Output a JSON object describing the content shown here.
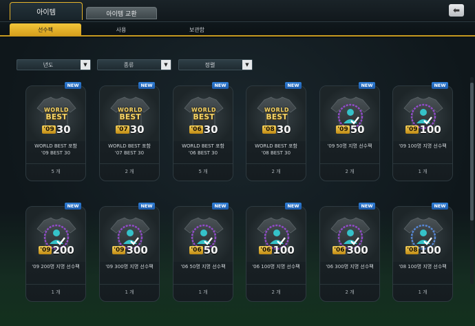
{
  "main_tabs": [
    {
      "label": "아이템",
      "active": true
    },
    {
      "label": "아이템 교환",
      "active": false
    }
  ],
  "sub_tabs": [
    {
      "label": "선수팩",
      "active": true
    },
    {
      "label": "사용",
      "active": false
    },
    {
      "label": "보관함",
      "active": false
    }
  ],
  "filters": [
    {
      "label": "년도"
    },
    {
      "label": "종류"
    },
    {
      "label": "정렬"
    }
  ],
  "badge_text": "NEW",
  "dropdown_glyph": "▼",
  "back_glyph": "⬅",
  "colors": {
    "accent": "#e8b52a",
    "new_badge": "#2f7fd8",
    "ring_purple": "#9b4bd8",
    "ring_blue": "#5a8ee6"
  },
  "cards": [
    {
      "kind": "world_best",
      "year": "'09",
      "number": "30",
      "wb_line1": "WORLD",
      "wb_line2": "BEST",
      "name": "WORLD BEST 포함\n'09 BEST 30",
      "qty": "5 개"
    },
    {
      "kind": "world_best",
      "year": "'07",
      "number": "30",
      "wb_line1": "WORLD",
      "wb_line2": "BEST",
      "name": "WORLD BEST 포함\n'07 BEST 30",
      "qty": "2 개"
    },
    {
      "kind": "world_best",
      "year": "'06",
      "number": "30",
      "wb_line1": "WORLD",
      "wb_line2": "BEST",
      "name": "WORLD BEST 포함\n'06 BEST 30",
      "qty": "5 개"
    },
    {
      "kind": "world_best",
      "year": "'08",
      "number": "30",
      "wb_line1": "WORLD",
      "wb_line2": "BEST",
      "name": "WORLD BEST 포함\n'08 BEST 30",
      "qty": "2 개"
    },
    {
      "kind": "ring",
      "year": "'09",
      "number": "50",
      "ring": "purple",
      "name": "'09 50명 지명 선수팩",
      "qty": "2 개"
    },
    {
      "kind": "ring",
      "year": "'09",
      "number": "100",
      "ring": "purple",
      "name": "'09 100명 지명 선수팩",
      "qty": "1 개"
    },
    {
      "kind": "ring",
      "year": "'09",
      "number": "200",
      "ring": "purple",
      "name": "'09 200명 지명 선수팩",
      "qty": "1 개"
    },
    {
      "kind": "ring",
      "year": "'09",
      "number": "300",
      "ring": "purple",
      "name": "'09 300명 지명 선수팩",
      "qty": "1 개"
    },
    {
      "kind": "ring",
      "year": "'06",
      "number": "50",
      "ring": "purple",
      "name": "'06 50명 지명 선수팩",
      "qty": "1 개"
    },
    {
      "kind": "ring",
      "year": "'06",
      "number": "100",
      "ring": "purple",
      "name": "'06 100명 지명 선수팩",
      "qty": "2 개"
    },
    {
      "kind": "ring",
      "year": "'06",
      "number": "300",
      "ring": "purple",
      "name": "'06 300명 지명 선수팩",
      "qty": "2 개"
    },
    {
      "kind": "ring",
      "year": "'08",
      "number": "100",
      "ring": "blue",
      "name": "'08 100명 지명 선수팩",
      "qty": "1 개"
    }
  ]
}
